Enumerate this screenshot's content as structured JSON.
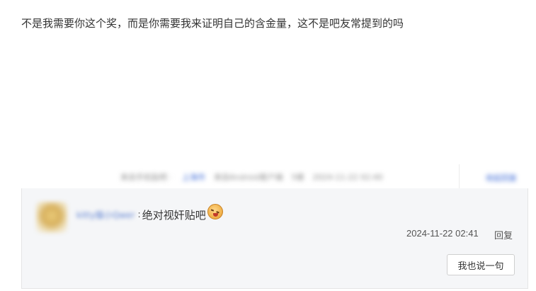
{
  "post": {
    "text": "不是我需要你这个奖，而是你需要我来证明自己的含金量，这不是吧友常提到的吗"
  },
  "meta": {
    "from": "来自手机贴吧 ·",
    "link": "上海市",
    "client": "来自Android客户端",
    "floor": "5楼",
    "time": "2024-11-22 02:40",
    "reply": "收起回复"
  },
  "reply": {
    "username": "kitty猫小Qwer",
    "colon": ":",
    "text": "绝对视奸贴吧",
    "emoji": "angry-face-emoji",
    "time": "2024-11-22 02:41",
    "reply_label": "回复",
    "say_button": "我也说一句"
  },
  "colors": {
    "link_blue": "#3a68d6",
    "reply_bg": "#f5f6f8",
    "text": "#333333"
  }
}
